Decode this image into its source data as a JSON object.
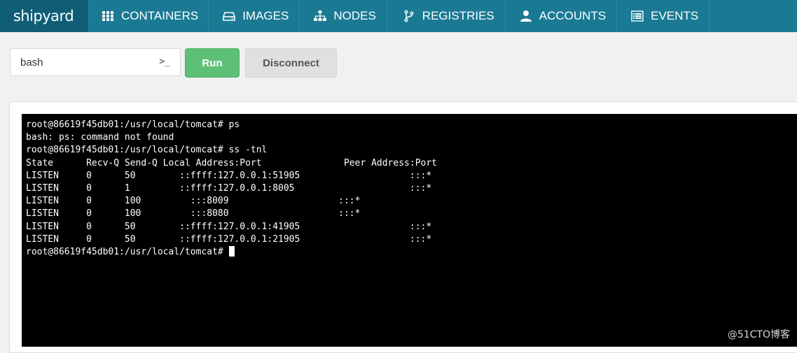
{
  "brand": "shipyard",
  "nav": [
    {
      "label": "CONTAINERS",
      "icon": "grid-icon"
    },
    {
      "label": "IMAGES",
      "icon": "hard-drive-icon"
    },
    {
      "label": "NODES",
      "icon": "sitemap-icon"
    },
    {
      "label": "REGISTRIES",
      "icon": "branch-icon"
    },
    {
      "label": "ACCOUNTS",
      "icon": "user-icon"
    },
    {
      "label": "EVENTS",
      "icon": "list-icon"
    }
  ],
  "command": {
    "value": "bash",
    "prompt_glyph": ">_"
  },
  "buttons": {
    "run": "Run",
    "disconnect": "Disconnect"
  },
  "terminal": {
    "lines": [
      "root@86619f45db01:/usr/local/tomcat# ps",
      "bash: ps: command not found",
      "root@86619f45db01:/usr/local/tomcat# ss -tnl",
      "State      Recv-Q Send-Q Local Address:Port               Peer Address:Port",
      "LISTEN     0      50        ::ffff:127.0.0.1:51905                    :::*",
      "LISTEN     0      1         ::ffff:127.0.0.1:8005                     :::*",
      "LISTEN     0      100         :::8009                    :::*",
      "LISTEN     0      100         :::8080                    :::*",
      "LISTEN     0      50        ::ffff:127.0.0.1:41905                    :::*",
      "LISTEN     0      50        ::ffff:127.0.0.1:21905                    :::*"
    ],
    "prompt": "root@86619f45db01:/usr/local/tomcat# "
  },
  "watermark": "@51CTO博客",
  "colors": {
    "nav_bg": "#1a7a94",
    "brand_bg": "#0f5e76",
    "run_green": "#5ebf77",
    "terminal_bg": "#000000"
  }
}
